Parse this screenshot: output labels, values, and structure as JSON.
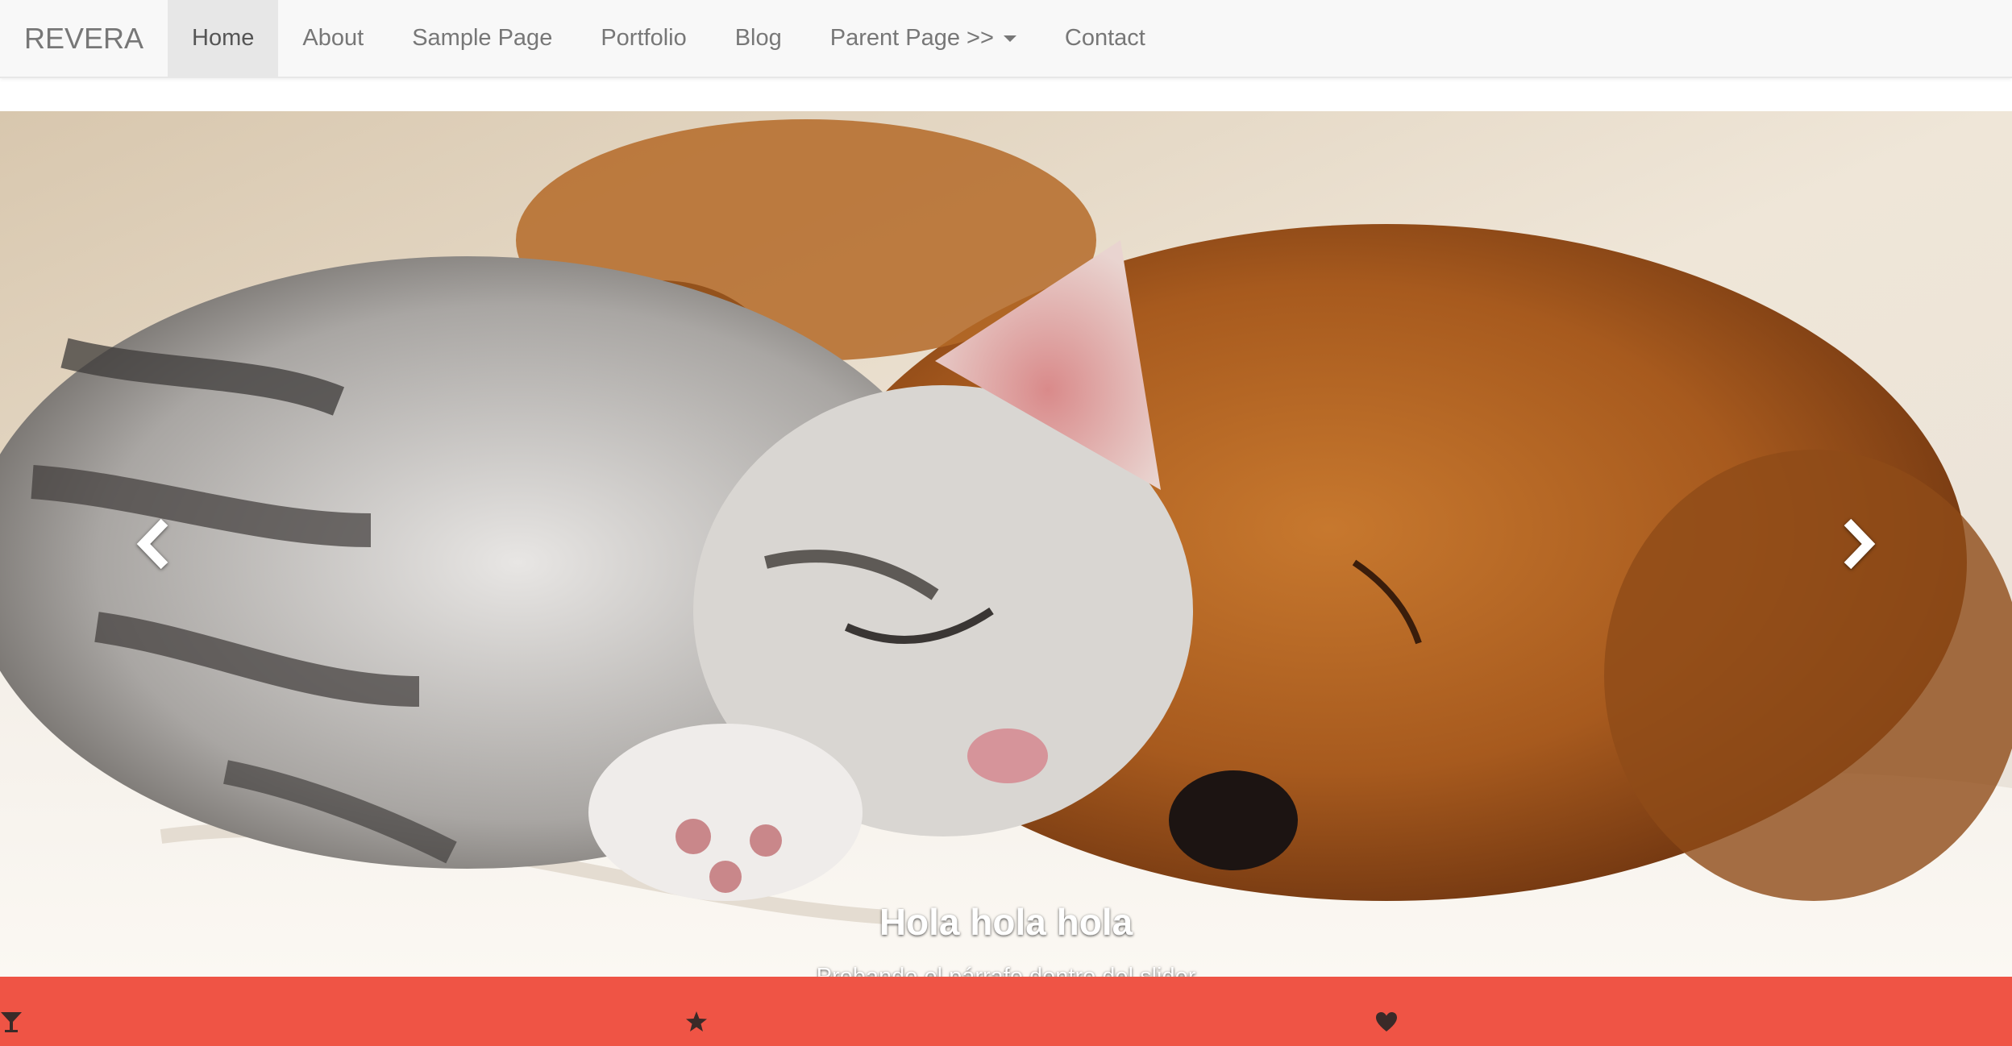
{
  "navbar": {
    "brand": "REVERA",
    "items": [
      {
        "label": "Home",
        "active": true
      },
      {
        "label": "About"
      },
      {
        "label": "Sample Page"
      },
      {
        "label": "Portfolio"
      },
      {
        "label": "Blog"
      },
      {
        "label": "Parent Page >>",
        "dropdown": true
      },
      {
        "label": "Contact"
      }
    ]
  },
  "slider": {
    "image": "kitten and puppy sleeping together",
    "caption_title": "Hola hola hola",
    "caption_text": "Probando el párrafo dentro del slider",
    "slide_count": 3,
    "active_slide": 2,
    "prev_icon": "chevron-left-icon",
    "next_icon": "chevron-right-icon"
  },
  "features": {
    "background": "#ef5445",
    "icons": [
      "glass-icon",
      "star-icon",
      "heart-icon"
    ]
  }
}
